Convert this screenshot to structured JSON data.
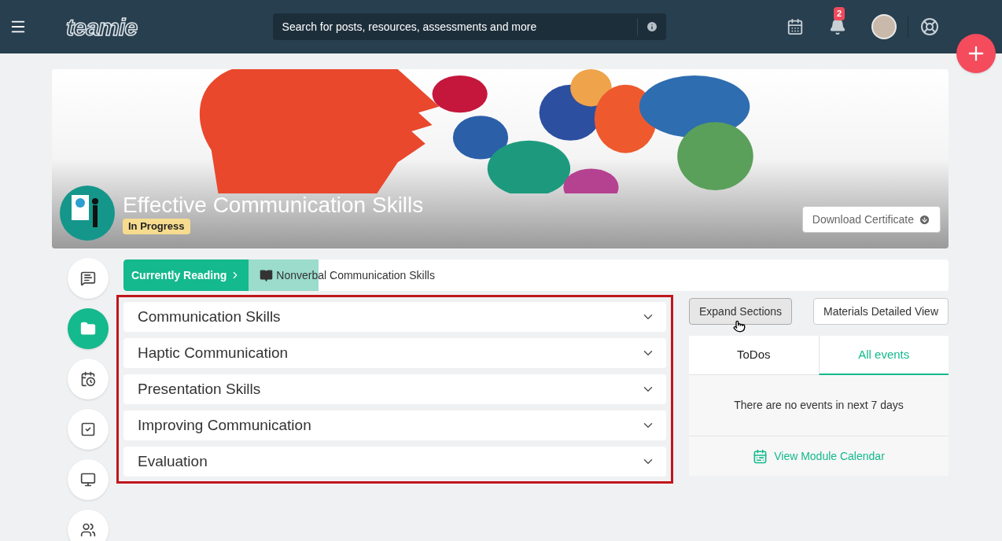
{
  "header": {
    "logo": "teamie",
    "search": {
      "placeholder": "Search for posts, resources, assessments and more"
    },
    "notification_count": "2"
  },
  "course": {
    "title": "Effective Communication Skills",
    "status": "In Progress",
    "download_button": "Download Certificate"
  },
  "rail": [
    {
      "kind": "posts",
      "selected": false
    },
    {
      "kind": "materials",
      "selected": true
    },
    {
      "kind": "schedule",
      "selected": false
    },
    {
      "kind": "tasks",
      "selected": false
    },
    {
      "kind": "classroom",
      "selected": false
    },
    {
      "kind": "people",
      "selected": false
    }
  ],
  "currently_reading": {
    "label": "Currently Reading",
    "item": "Nonverbal Communication Skills",
    "level": 0.1
  },
  "sections": [
    {
      "title": "Communication Skills",
      "expanded": false
    },
    {
      "title": "Haptic Communication",
      "expanded": false
    },
    {
      "title": "Presentation Skills",
      "expanded": false
    },
    {
      "title": "Improving Communication",
      "expanded": false
    },
    {
      "title": "Evaluation",
      "expanded": false
    }
  ],
  "buttons": [
    {
      "label": "Expand Sections",
      "hovered": true
    },
    {
      "label": "Materials Detailed View",
      "hovered": false
    }
  ],
  "events_panel": {
    "tabs": [
      {
        "label": "ToDos",
        "selected": false
      },
      {
        "label": "All events",
        "selected": true
      }
    ],
    "message": "There are no events in next 7 days",
    "link": "View Module Calendar"
  }
}
